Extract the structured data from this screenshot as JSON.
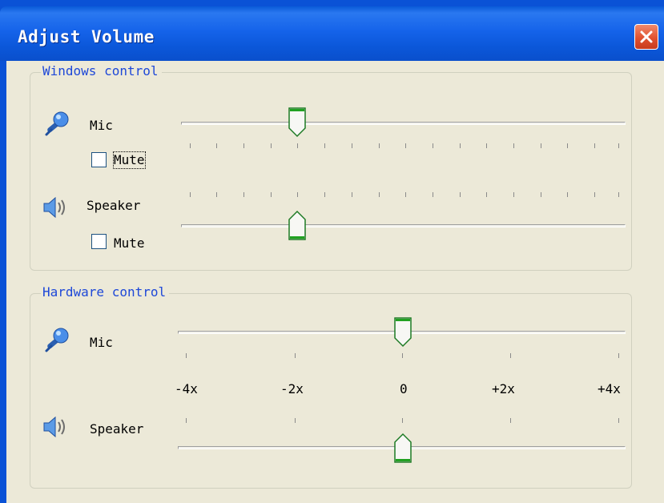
{
  "window": {
    "title": "Adjust Volume",
    "close_icon": "close-icon",
    "accent_color": "#0a52d6",
    "close_color": "#e0512f"
  },
  "windows_control": {
    "group_title": "Windows control",
    "mic": {
      "label": "Mic",
      "icon": "microphone-icon",
      "mute_label": "Mute",
      "mute_checked": false,
      "level_percent": 25
    },
    "speaker": {
      "label": "Speaker",
      "icon": "speaker-icon",
      "mute_label": "Mute",
      "mute_checked": false,
      "level_percent": 25
    }
  },
  "hardware_control": {
    "group_title": "Hardware control",
    "mic": {
      "label": "Mic",
      "icon": "microphone-icon",
      "level": "0"
    },
    "speaker": {
      "label": "Speaker",
      "icon": "speaker-icon",
      "level": "0"
    },
    "scale_labels": [
      "-4x",
      "-2x",
      "0",
      "+2x",
      "+4x"
    ]
  }
}
